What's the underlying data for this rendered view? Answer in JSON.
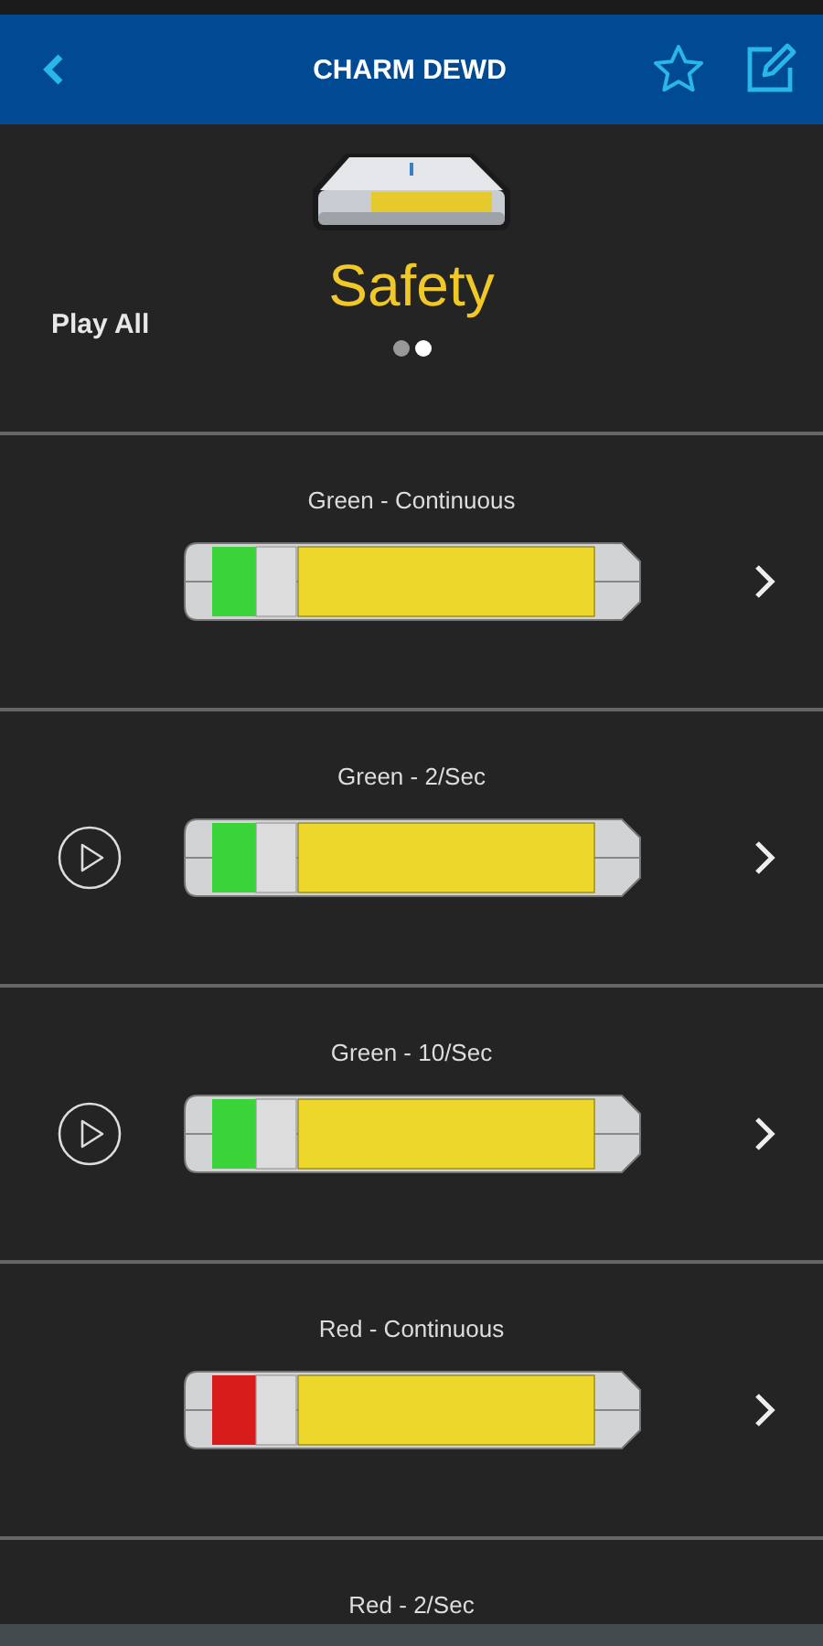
{
  "header": {
    "title": "CHARM DEWD"
  },
  "section": {
    "title": "Safety",
    "play_all": "Play All"
  },
  "pager": [
    {
      "selected": false
    },
    {
      "selected": true
    }
  ],
  "patterns": [
    {
      "label": "Green - Continuous",
      "play": false,
      "color": "#3ad43a"
    },
    {
      "label": "Green - 2/Sec",
      "play": true,
      "color": "#3ad43a"
    },
    {
      "label": "Green - 10/Sec",
      "play": true,
      "color": "#3ad43a"
    },
    {
      "label": "Red - Continuous",
      "play": false,
      "color": "#d81c1c"
    },
    {
      "label": "Red - 2/Sec"
    }
  ]
}
